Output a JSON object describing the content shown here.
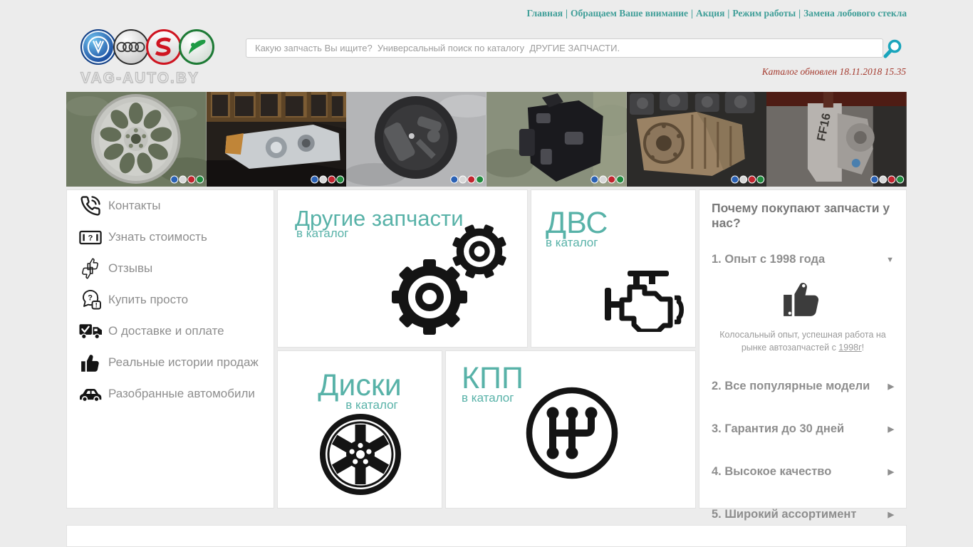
{
  "topnav": {
    "separator": "|",
    "items": [
      "Главная",
      "Обращаем Ваше внимание",
      "Акция",
      "Режим работы",
      "Замена лобового стекла"
    ]
  },
  "header": {
    "brand": "VAG-AUTO.BY",
    "search_placeholder": "Какую запчасть Вы ищите?  Универсальный поиск по каталогу  ДРУГИЕ ЗАПЧАСТИ.",
    "catalog_updated": "Каталог обновлен 18.11.2018 15.35"
  },
  "gallery": {
    "photos": [
      {
        "name": "alloy-wheel"
      },
      {
        "name": "headlight"
      },
      {
        "name": "spare-tool-kit"
      },
      {
        "name": "gearbox-dark"
      },
      {
        "name": "gearbox-rusty"
      },
      {
        "name": "gearbox-ff16",
        "label": "FF16"
      }
    ]
  },
  "sidebar": {
    "items": [
      {
        "label": "Контакты"
      },
      {
        "label": "Узнать стоимость"
      },
      {
        "label": "Отзывы"
      },
      {
        "label": "Купить просто"
      },
      {
        "label": "О доставке и оплате"
      },
      {
        "label": "Реальные истории продаж"
      },
      {
        "label": "Разобранные автомобили"
      }
    ]
  },
  "cards": [
    {
      "title": "Другие запчасти",
      "subtitle": "в каталог"
    },
    {
      "title": "ДВС",
      "subtitle": "в каталог"
    },
    {
      "title": "Диски",
      "subtitle": "в каталог"
    },
    {
      "title": "КПП",
      "subtitle": "в каталог"
    }
  ],
  "why": {
    "title": "Почему покупают запчасти у нас?",
    "items": [
      {
        "label": "1. Опыт с 1998 года",
        "arrow": "▼",
        "expanded": true,
        "content_prefix": "Колосальный опыт, успешная работа на рынке автозапчастей с ",
        "content_link": "1998г",
        "content_suffix": "!"
      },
      {
        "label": "2. Все популярные модели",
        "arrow": "▶"
      },
      {
        "label": "3. Гарантия до 30 дней",
        "arrow": "▶"
      },
      {
        "label": "4. Высокое качество",
        "arrow": "▶"
      },
      {
        "label": "5. Широкий ассортимент",
        "arrow": "▶"
      }
    ]
  },
  "glyphs": {
    "question": "?",
    "exclamation": "!"
  },
  "colors": {
    "accent_teal": "#58b2a8",
    "nav_teal": "#3f9e98",
    "search_icon_teal": "#1aa5bc",
    "updated_red": "#a43a2e"
  }
}
